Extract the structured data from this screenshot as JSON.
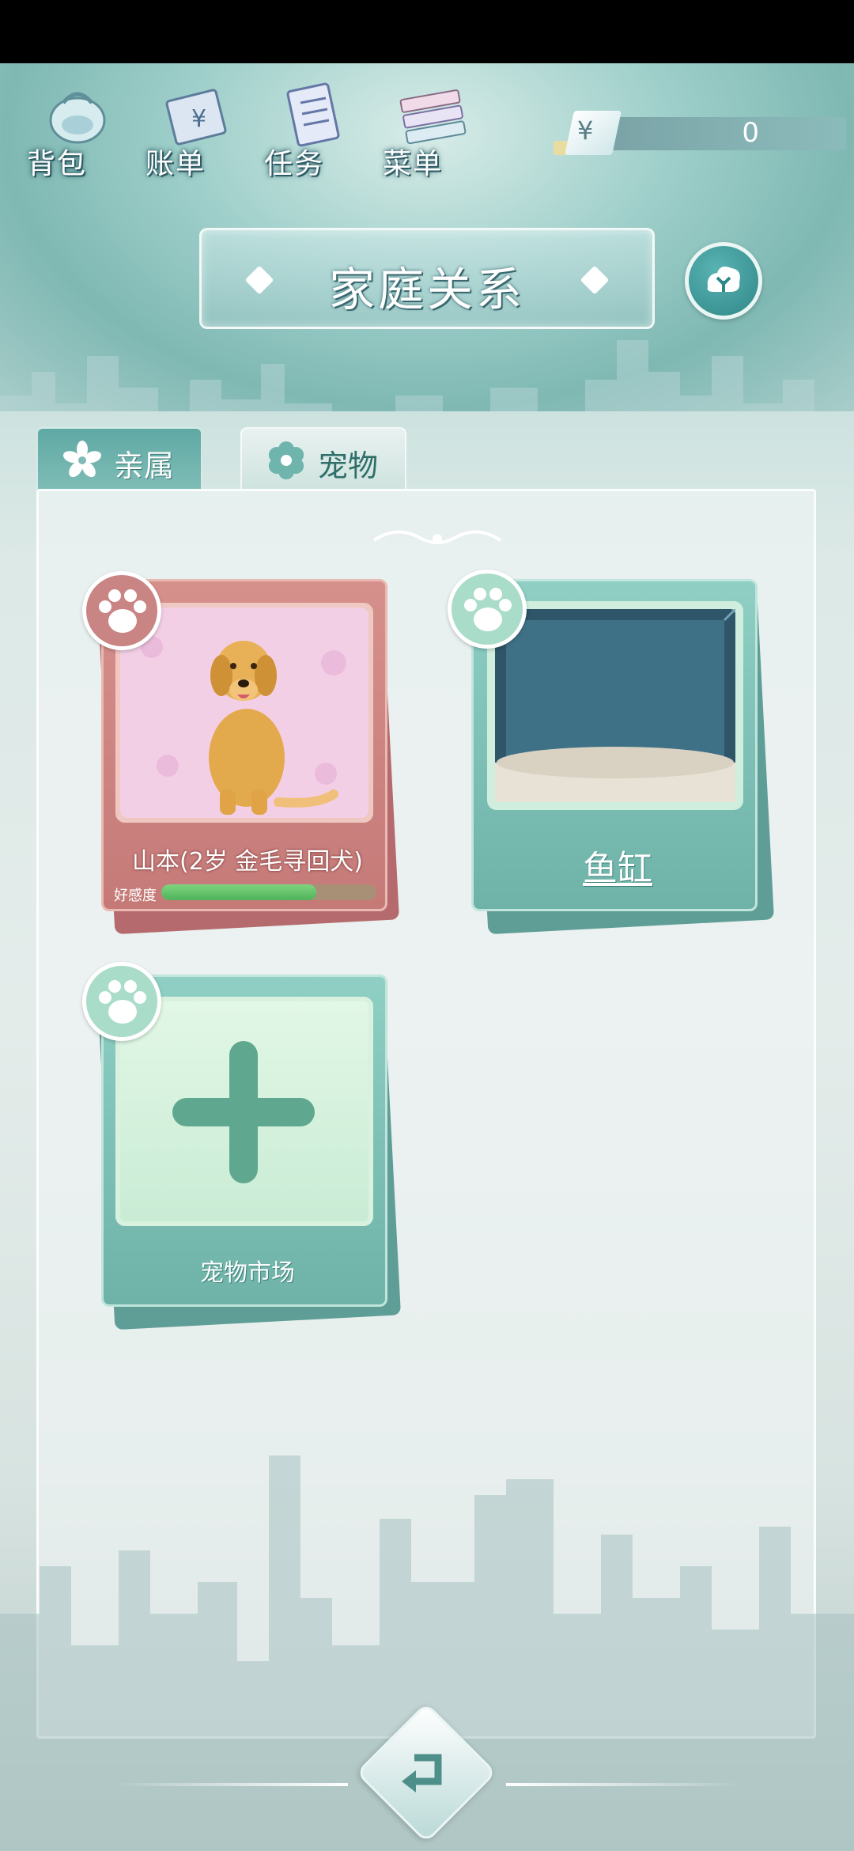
{
  "topnav": {
    "items": [
      {
        "label": "背包",
        "icon": "backpack-icon"
      },
      {
        "label": "账单",
        "icon": "bill-icon"
      },
      {
        "label": "任务",
        "icon": "task-icon"
      },
      {
        "label": "菜单",
        "icon": "menu-icon"
      }
    ]
  },
  "currency": {
    "symbol": "¥",
    "value": "0"
  },
  "header": {
    "title": "家庭关系"
  },
  "tabs": [
    {
      "label": "亲属",
      "active": false
    },
    {
      "label": "宠物",
      "active": true
    }
  ],
  "cards": {
    "dog": {
      "name": "山本(2岁 金毛寻回犬)",
      "favor_label": "好感度",
      "favor": 0.72
    },
    "fish_tank": {
      "label": "鱼缸"
    },
    "market": {
      "label": "宠物市场"
    }
  },
  "colors": {
    "teal": "#7fbcb6",
    "dog_card": "#c98484",
    "favor_fill": "#5cc063"
  }
}
